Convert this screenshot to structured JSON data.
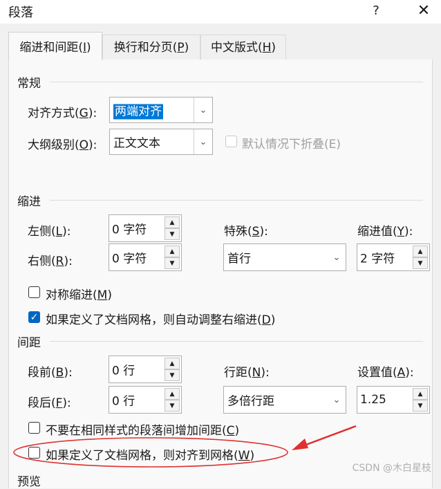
{
  "window": {
    "title": "段落",
    "help_label": "?",
    "close_label": "✕"
  },
  "tabs": [
    {
      "label": "缩进和间距(",
      "mnemonic": "I",
      "suffix": ")"
    },
    {
      "label": "换行和分页(",
      "mnemonic": "P",
      "suffix": ")"
    },
    {
      "label": "中文版式(",
      "mnemonic": "H",
      "suffix": ")"
    }
  ],
  "general": {
    "title": "常规",
    "alignment": {
      "label": "对齐方式(",
      "mnemonic": "G",
      "suffix": "):",
      "value": "两端对齐"
    },
    "outline": {
      "label": "大纲级别(",
      "mnemonic": "O",
      "suffix": "):",
      "value": "正文文本"
    },
    "collapse": {
      "label": "默认情况下折叠(E)"
    }
  },
  "indent": {
    "title": "缩进",
    "left": {
      "label": "左侧(",
      "mnemonic": "L",
      "suffix": "):",
      "value": "0 字符"
    },
    "right": {
      "label": "右侧(",
      "mnemonic": "R",
      "suffix": "):",
      "value": "0 字符"
    },
    "special": {
      "label": "特殊(",
      "mnemonic": "S",
      "suffix": "):",
      "value": "首行"
    },
    "indent_value": {
      "label": "缩进值(",
      "mnemonic": "Y",
      "suffix": "):",
      "value": "2 字符"
    },
    "mirror": {
      "label": "对称缩进(",
      "mnemonic": "M",
      "suffix": ")"
    },
    "auto_adjust": {
      "label": "如果定义了文档网格，则自动调整右缩进(",
      "mnemonic": "D",
      "suffix": ")"
    }
  },
  "spacing": {
    "title": "间距",
    "before": {
      "label": "段前(",
      "mnemonic": "B",
      "suffix": "):",
      "value": "0 行"
    },
    "after": {
      "label": "段后(",
      "mnemonic": "F",
      "suffix": "):",
      "value": "0 行"
    },
    "line_spacing": {
      "label": "行距(",
      "mnemonic": "N",
      "suffix": "):",
      "value": "多倍行距"
    },
    "at": {
      "label": "设置值(",
      "mnemonic": "A",
      "suffix": "):",
      "value": "1.25"
    },
    "no_space_same_style": {
      "label": "不要在相同样式的段落间增加间距(",
      "mnemonic": "C",
      "suffix": ")"
    },
    "snap_to_grid": {
      "label": "如果定义了文档网格，则对齐到网格(",
      "mnemonic": "W",
      "suffix": ")"
    }
  },
  "preview": {
    "title": "预览"
  },
  "watermark": "CSDN @木白星枝",
  "colors": {
    "highlight": "#0078d7",
    "annotation": "#e03030",
    "checkbox_checked": "#0067c0"
  }
}
